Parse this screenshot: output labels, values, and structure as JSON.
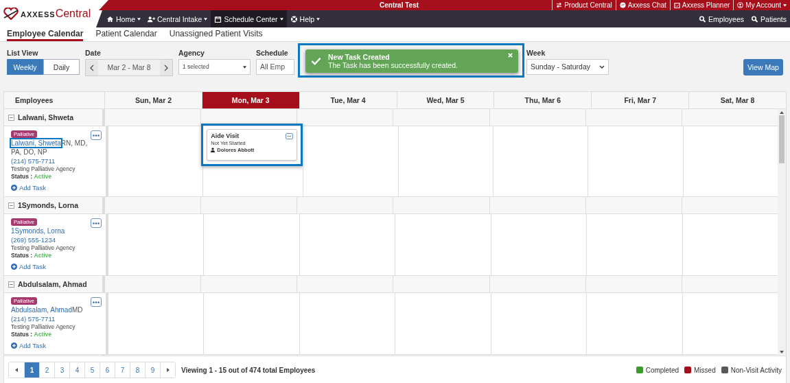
{
  "top_bar": {
    "logo": {
      "part_1": "AXXESS",
      "part_2": "Central"
    },
    "title": "Central Test",
    "links": [
      {
        "kind": "swap",
        "label": "Product Central",
        "caret": false
      },
      {
        "kind": "chat",
        "label": "Axxess Chat",
        "caret": false
      },
      {
        "kind": "calendar",
        "label": "Axxess Planner",
        "caret": false
      },
      {
        "kind": "user",
        "label": "My Account",
        "caret": true
      }
    ]
  },
  "nav": {
    "items": [
      {
        "kind": "home",
        "label": "Home",
        "selected": false
      },
      {
        "kind": "user-plus",
        "label": "Central Intake",
        "selected": false
      },
      {
        "kind": "calendar",
        "label": "Schedule Center",
        "selected": true
      },
      {
        "kind": "help",
        "label": "Help",
        "selected": false
      }
    ],
    "search_links": [
      "Employees",
      "Patients"
    ]
  },
  "subtabs": [
    {
      "label": "Employee Calendar",
      "selected": true
    },
    {
      "label": "Patient Calendar",
      "selected": false
    },
    {
      "label": "Unassigned Patient Visits",
      "selected": false
    }
  ],
  "filters": {
    "list_view": {
      "label": "List View",
      "options": [
        {
          "label": "Weekly",
          "selected": true
        },
        {
          "label": "Daily",
          "selected": false
        }
      ]
    },
    "date": {
      "label": "Date",
      "range": "Mar 2 - Mar 8"
    },
    "agency": {
      "label": "Agency",
      "value": "1 selected"
    },
    "schedule": {
      "label": "Schedule",
      "value": "All Emp"
    },
    "week": {
      "label": "Week",
      "value": "Sunday - Saturday"
    },
    "view_map": "View Map"
  },
  "toast": {
    "title": "New Task Created",
    "message": "The Task has been successfully created.",
    "highlighted": true
  },
  "calendar": {
    "first_column": "Employees",
    "days": [
      {
        "label": "Sun, Mar 2",
        "selected": false
      },
      {
        "label": "Mon, Mar 3",
        "selected": true
      },
      {
        "label": "Tue, Mar 4",
        "selected": false
      },
      {
        "label": "Wed, Mar 5",
        "selected": false
      },
      {
        "label": "Thu, Mar 6",
        "selected": false
      },
      {
        "label": "Fri, Mar 7",
        "selected": false
      },
      {
        "label": "Sat, Mar 8",
        "selected": false
      }
    ],
    "employees": [
      {
        "group": "Lalwani, Shweta",
        "expanded": true,
        "badge": "Palliative",
        "name": "Lalwani, Shweta",
        "name_highlighted": true,
        "credentials": "RN, MD, PA, DO, NP",
        "phone": "(214) 575-7711",
        "agency": "Testing Palliative Agency",
        "status_label": "Status :",
        "status": "Active",
        "add_task": "Add Task",
        "tasks": [
          {
            "title": "Aide Visit",
            "status": "Not Yet Started",
            "assignee": "Dolores Abbott",
            "highlighted": true
          }
        ]
      },
      {
        "group": "1Symonds, Lorna",
        "expanded": true,
        "badge": "Palliative",
        "name": "1Symonds, Lorna",
        "name_highlighted": false,
        "phone": "(269) 555-1234",
        "agency": "Testing Palliative Agency",
        "status_label": "Status :",
        "status": "Active",
        "add_task": "Add Task"
      },
      {
        "group": "Abdulsalam, Ahmad",
        "expanded": true,
        "badge": "Palliative",
        "name": "Abdulsalam, Ahmad",
        "name_highlighted": false,
        "credentials": "MD",
        "phone": "(214) 575-7711",
        "agency": "Testing Palliative Agency",
        "status_label": "Status :",
        "status": "Active",
        "add_task": "Add Task"
      }
    ]
  },
  "pagination": {
    "pages": [
      {
        "label": "1",
        "selected": true
      },
      {
        "label": "2",
        "selected": false
      },
      {
        "label": "3",
        "selected": false
      },
      {
        "label": "4",
        "selected": false
      },
      {
        "label": "5",
        "selected": false
      },
      {
        "label": "6",
        "selected": false
      },
      {
        "label": "7",
        "selected": false
      },
      {
        "label": "8",
        "selected": false
      },
      {
        "label": "9",
        "selected": false
      }
    ],
    "summary": "Viewing 1 - 15 out of 474 total Employees"
  },
  "legend": [
    {
      "label": "Completed",
      "color": "#3c9a2e"
    },
    {
      "label": "Missed",
      "color": "#a50e1b"
    },
    {
      "label": "Non-Visit Activity",
      "color": "#5a5a5a"
    }
  ]
}
